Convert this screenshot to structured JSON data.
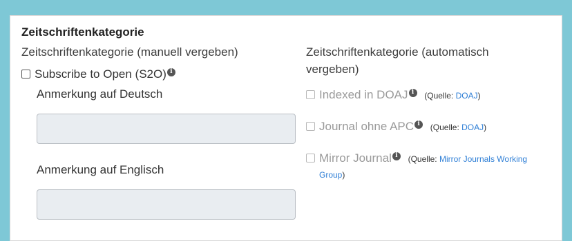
{
  "section": {
    "heading": "Zeitschriftenkategorie"
  },
  "manual": {
    "subhead": "Zeitschriftenkategorie (manuell vergeben)",
    "checkbox_label": "Subscribe to Open (S2O)",
    "checkbox_checked": false,
    "note_de_label": "Anmerkung auf Deutsch",
    "note_de_value": "",
    "note_en_label": "Anmerkung auf Englisch",
    "note_en_value": ""
  },
  "automatic": {
    "subhead": "Zeitschriftenkategorie (automatisch vergeben)",
    "items": [
      {
        "label": "Indexed in DOAJ",
        "source_prefix": "(Quelle: ",
        "source_link": "DOAJ",
        "source_suffix": ")",
        "checked": false
      },
      {
        "label": "Journal ohne APC",
        "source_prefix": "(Quelle: ",
        "source_link": "DOAJ",
        "source_suffix": ")",
        "checked": false
      },
      {
        "label": "Mirror Journal",
        "source_prefix": "(Quelle: ",
        "source_link": "Mirror Journals Working Group",
        "source_suffix": ")",
        "checked": false
      }
    ]
  },
  "icons": {
    "info": "info-icon"
  },
  "colors": {
    "background": "#7ec8d6",
    "link": "#2f7fd6",
    "textbox_fill": "#e9edf1"
  }
}
